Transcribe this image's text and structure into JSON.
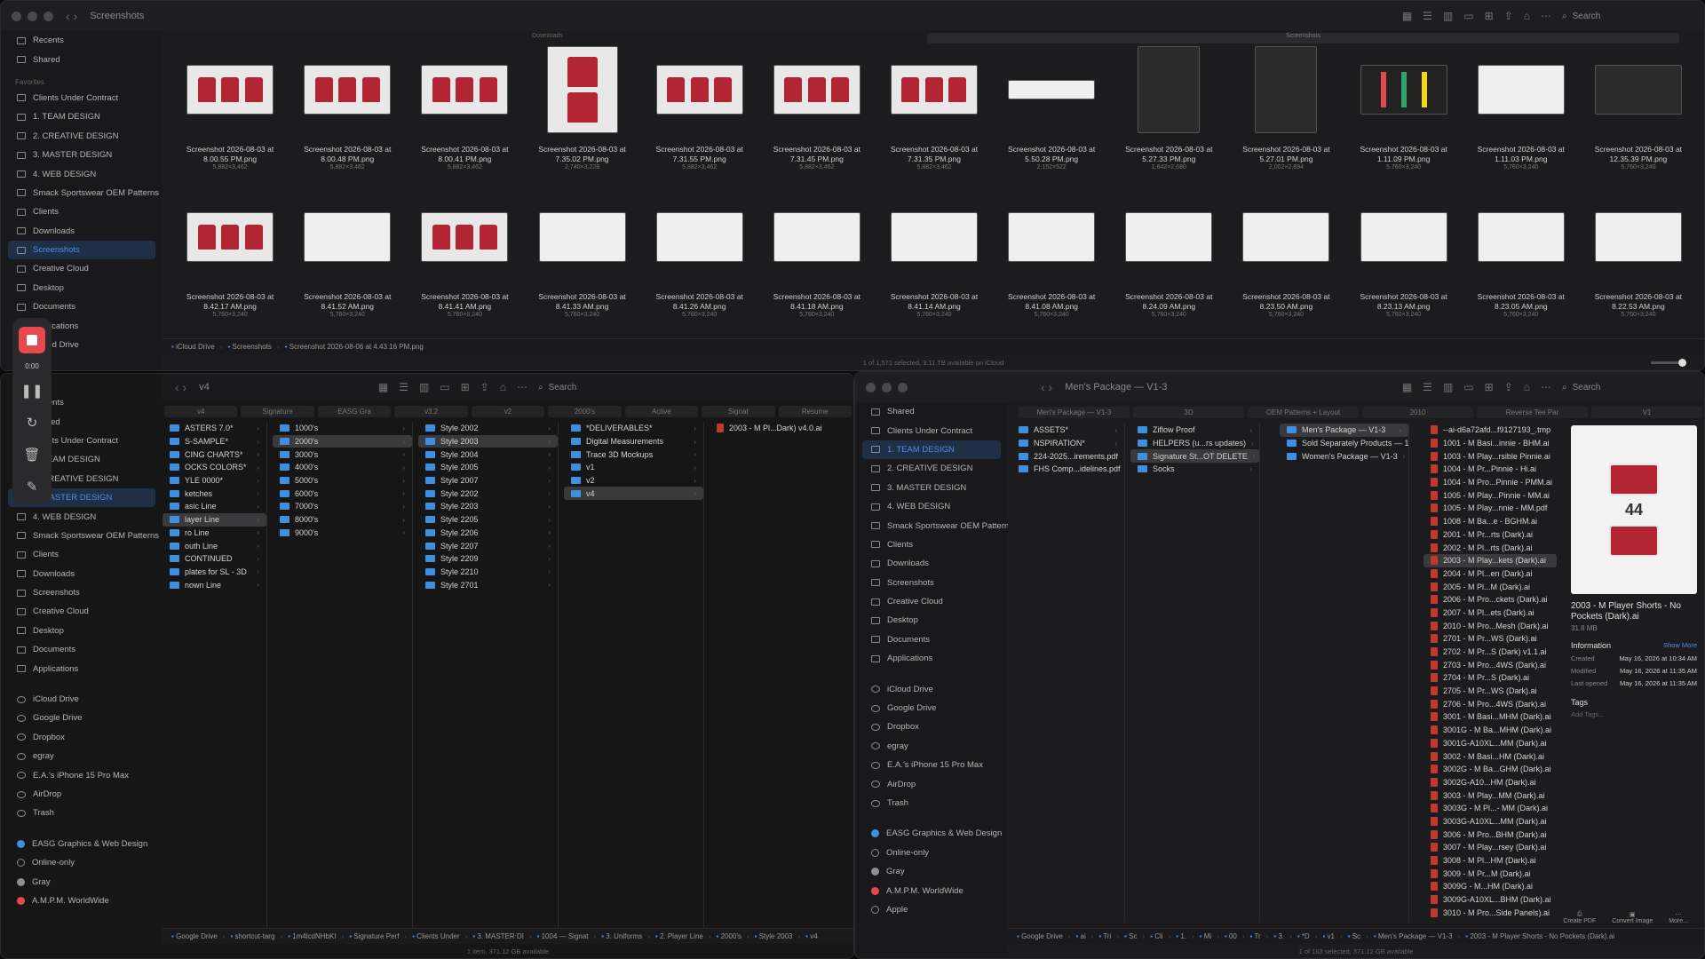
{
  "w1": {
    "title": "Screenshots",
    "search": "Search",
    "tabs": [
      "Downloads",
      "Screenshots"
    ],
    "sidebar": [
      {
        "section": "",
        "items": [
          {
            "label": "Recents",
            "icon": "clock-icon"
          },
          {
            "label": "Shared",
            "icon": "shared-icon"
          }
        ]
      },
      {
        "section": "Favorites",
        "items": [
          {
            "label": "Clients Under Contract"
          },
          {
            "label": "1. TEAM DESIGN"
          },
          {
            "label": "2. CREATIVE DESIGN"
          },
          {
            "label": "3. MASTER DESIGN"
          },
          {
            "label": "4. WEB DESIGN"
          },
          {
            "label": "Smack Sportswear OEM Patterns"
          },
          {
            "label": "Clients"
          },
          {
            "label": "Downloads",
            "icon": "download-icon"
          },
          {
            "label": "Screenshots",
            "sel": true
          },
          {
            "label": "Creative Cloud"
          },
          {
            "label": "Desktop"
          },
          {
            "label": "Documents"
          },
          {
            "label": "Applications"
          },
          {
            "label": "iCloud Drive"
          }
        ]
      }
    ],
    "files": [
      {
        "name": "Screenshot 2026-08-03 at 8.00.55 PM.png",
        "dims": "5,882×3,462",
        "t": "red"
      },
      {
        "name": "Screenshot 2026-08-03 at 8.00.48 PM.png",
        "dims": "5,882×3,462",
        "t": "red"
      },
      {
        "name": "Screenshot 2026-08-03 at 8.00.41 PM.png",
        "dims": "5,882×3,462",
        "t": "red"
      },
      {
        "name": "Screenshot 2026-08-03 at 7.35.02 PM.png",
        "dims": "2,740×3,228",
        "t": "tall"
      },
      {
        "name": "Screenshot 2026-08-03 at 7.31.55 PM.png",
        "dims": "5,882×3,462",
        "t": "red"
      },
      {
        "name": "Screenshot 2026-08-03 at 7.31.45 PM.png",
        "dims": "5,882×3,462",
        "t": "red"
      },
      {
        "name": "Screenshot 2026-08-03 at 7.31.35 PM.png",
        "dims": "5,882×3,462",
        "t": "red"
      },
      {
        "name": "Screenshot 2026-08-03 at 5.50.28 PM.png",
        "dims": "2,152×522",
        "t": "wide"
      },
      {
        "name": "Screenshot 2026-08-03 at 5.27.33 PM.png",
        "dims": "1,642×2,680",
        "t": "darktall"
      },
      {
        "name": "Screenshot 2026-08-03 at 5.27.01 PM.png",
        "dims": "2,002×2,694",
        "t": "darktall"
      },
      {
        "name": "Screenshot 2026-08-03 at 1.11.09 PM.png",
        "dims": "5,760×3,240",
        "t": "bars"
      },
      {
        "name": "Screenshot 2026-08-03 at 1.11.03 PM.png",
        "dims": "5,760×3,240",
        "t": "blank"
      },
      {
        "name": "Screenshot 2026-08-03 at 12.35.39 PM.png",
        "dims": "5,760×3,240",
        "t": "dark"
      },
      {
        "name": "Screenshot 2026-08-03 at 8.42.17 AM.png",
        "dims": "5,760×3,240",
        "t": "red"
      },
      {
        "name": "Screenshot 2026-08-03 at 8.41.52 AM.png",
        "dims": "5,760×3,240",
        "t": "blank"
      },
      {
        "name": "Screenshot 2026-08-03 at 8.41.41 AM.png",
        "dims": "5,760×3,240",
        "t": "red"
      },
      {
        "name": "Screenshot 2026-08-03 at 8.41.33 AM.png",
        "dims": "5,760×3,240",
        "t": "blank"
      },
      {
        "name": "Screenshot 2026-08-03 at 8.41.26 AM.png",
        "dims": "5,760×3,240",
        "t": "blank"
      },
      {
        "name": "Screenshot 2026-08-03 at 8.41.18 AM.png",
        "dims": "5,760×3,240",
        "t": "blank"
      },
      {
        "name": "Screenshot 2026-08-03 at 8.41.14 AM.png",
        "dims": "5,760×3,240",
        "t": "blank"
      },
      {
        "name": "Screenshot 2026-08-03 at 8.41.08 AM.png",
        "dims": "5,760×3,240",
        "t": "blank"
      },
      {
        "name": "Screenshot 2026-08-03 at 8.24.09 AM.png",
        "dims": "5,760×3,240",
        "t": "blank"
      },
      {
        "name": "Screenshot 2026-08-03 at 8.23.50 AM.png",
        "dims": "5,760×3,240",
        "t": "blank"
      },
      {
        "name": "Screenshot 2026-08-03 at 8.23.13 AM.png",
        "dims": "5,760×3,240",
        "t": "blank"
      },
      {
        "name": "Screenshot 2026-08-03 at 8.23.05 AM.png",
        "dims": "5,760×3,240",
        "t": "blank"
      },
      {
        "name": "Screenshot 2026-08-03 at 8.22.53 AM.png",
        "dims": "5,760×3,240",
        "t": "blank"
      }
    ],
    "path": [
      "iCloud Drive",
      "Screenshots",
      "Screenshot 2026-08-06 at 4.43.16 PM.png"
    ],
    "status": "1 of 1,571 selected, 3.11 TB available on iCloud"
  },
  "rec": {
    "time": "0:00"
  },
  "w2": {
    "title": "v4",
    "search": "Search",
    "colheads": [
      "v4",
      "Signature",
      "EASG Gra",
      "v3.2",
      "v2",
      "2000's",
      "Active",
      "Signat",
      "Resume"
    ],
    "sidebar": [
      {
        "label": "Recents"
      },
      {
        "label": "Shared"
      },
      {
        "label": "Clients Under Contract"
      },
      {
        "label": "1. TEAM DESIGN"
      },
      {
        "label": "2. CREATIVE DESIGN"
      },
      {
        "label": "3. MASTER DESIGN",
        "sel": true
      },
      {
        "label": "4. WEB DESIGN"
      },
      {
        "label": "Smack Sportswear OEM Patterns"
      },
      {
        "label": "Clients"
      },
      {
        "label": "Downloads"
      },
      {
        "label": "Screenshots"
      },
      {
        "label": "Creative Cloud"
      },
      {
        "label": "Desktop"
      },
      {
        "label": "Documents"
      },
      {
        "label": "Applications"
      }
    ],
    "locations": [
      "iCloud Drive",
      "Google Drive",
      "Dropbox",
      "egray",
      "E.A.'s iPhone 15 Pro Max",
      "AirDrop",
      "Trash"
    ],
    "tags": [
      {
        "label": "EASG Graphics & Web Design",
        "c": "#3f8ee0"
      },
      {
        "label": "Online-only",
        "c": ""
      },
      {
        "label": "Gray",
        "c": "#8e8e93"
      },
      {
        "label": "A.M.P.M. WorldWide",
        "c": "#e5484d"
      }
    ],
    "col1": [
      "ASTERS 7.0*",
      "S-SAMPLE*",
      "CING CHARTS*",
      "OCKS COLORS*",
      "YLE 0000*",
      "ketches",
      "asic Line",
      "layer Line",
      "ro Line",
      "outh Line",
      "CONTINUED",
      "plates for SL - 3D",
      "nown Line"
    ],
    "col2": [
      "1000's",
      "2000's",
      "3000's",
      "4000's",
      "5000's",
      "6000's",
      "7000's",
      "8000's",
      "9000's"
    ],
    "col3": [
      "Style 2002",
      "Style 2003",
      "Style 2004",
      "Style 2005",
      "Style 2007",
      "Style 2202",
      "Style 2203",
      "Style 2205",
      "Style 2206",
      "Style 2207",
      "Style 2209",
      "Style 2210",
      "Style 2701"
    ],
    "col4": [
      "*DELIVERABLES*",
      "Digital Measurements",
      "Trace 3D Mockups",
      "v1",
      "v2",
      "v4"
    ],
    "col5": [
      "2003 - M Pl...Dark) v4.0.ai"
    ],
    "path": [
      "Google Drive",
      "shortcut-targ",
      "1m4lcdNHbKI",
      "Signature Perf",
      "Clients Under",
      "3. MASTER DI",
      "1004 — Signat",
      "3. Uniforms",
      "2. Player Line",
      "2000's",
      "Style 2003",
      "v4"
    ],
    "status": "1 item, 371.12 GB available"
  },
  "w3": {
    "title": "Men's Package — V1-3",
    "search": "Search",
    "tabs": [
      "Men's Package — V1-3",
      "3D",
      "OEM Patterns + Layout",
      "2010",
      "Reverse Tee Par",
      "V1"
    ],
    "sidebar": [
      {
        "label": "Shared"
      },
      {
        "label": "Clients Under Contract"
      },
      {
        "label": "1. TEAM DESIGN",
        "sel": true
      },
      {
        "label": "2. CREATIVE DESIGN"
      },
      {
        "label": "3. MASTER DESIGN"
      },
      {
        "label": "4. WEB DESIGN"
      },
      {
        "label": "Smack Sportswear OEM Patterns"
      },
      {
        "label": "Clients"
      },
      {
        "label": "Downloads"
      },
      {
        "label": "Screenshots"
      },
      {
        "label": "Creative Cloud"
      },
      {
        "label": "Desktop"
      },
      {
        "label": "Documents"
      },
      {
        "label": "Applications"
      }
    ],
    "locations": [
      "iCloud Drive",
      "Google Drive",
      "Dropbox",
      "egray",
      "E.A.'s iPhone 15 Pro Max",
      "AirDrop",
      "Trash"
    ],
    "tags": [
      {
        "label": "EASG Graphics & Web Design",
        "c": "#3f8ee0"
      },
      {
        "label": "Online-only",
        "c": ""
      },
      {
        "label": "Gray",
        "c": "#8e8e93"
      },
      {
        "label": "A.M.P.M. WorldWide",
        "c": "#e5484d"
      },
      {
        "label": "Apple",
        "c": ""
      }
    ],
    "col1": [
      "ASSETS*",
      "NSPIRATION*",
      "224-2025...irements.pdf",
      "FHS Comp...idelines.pdf"
    ],
    "col2": [
      "Ziflow Proof",
      "HELPERS (u...rs updates)",
      "Signature St...OT DELETE",
      "Socks"
    ],
    "col3": [
      "Men's Package — V1-3",
      "Sold Separately Products — 1",
      "Women's Package — V1-3"
    ],
    "col4": [
      "--ai-d6a72afd...f9127193_.tmp",
      "1001 - M Basi...innie - BHM.ai",
      "1003 - M Play...rsible Pinnie.ai",
      "1004 - M Pr...Pinnie - Hi.ai",
      "1004 - M Pro...Pinnie - PMM.ai",
      "1005 - M Play...Pinnie - MM.ai",
      "1005 - M Play...nnie - MM.pdf",
      "1008 - M Ba...e - BGHM.ai",
      "2001 - M Pr...rts (Dark).ai",
      "2002 - M Pl...rts (Dark).ai",
      "2003 - M Play...kets (Dark).ai",
      "2004 - M Pl...en (Dark).ai",
      "2005 - M Pl...M (Dark).ai",
      "2006 - M Pro...ckets (Dark).ai",
      "2007 - M Pl...ets (Dark).ai",
      "2010 - M Pro...Mesh (Dark).ai",
      "2701 - M Pr...WS (Dark).ai",
      "2702 - M Pr...S (Dark) v1.1.ai",
      "2703 - M Pro...4WS (Dark).ai",
      "2704 - M Pr...S (Dark).ai",
      "2705 - M Pr...WS (Dark).ai",
      "2706 - M Pro...4WS (Dark).ai",
      "3001 - M Basi...MHM (Dark).ai",
      "3001G - M Ba...MHM (Dark).ai",
      "3001G-A10XL...MM (Dark).ai",
      "3002 - M Basi...HM (Dark).ai",
      "3002G - M Ba...GHM (Dark).ai",
      "3002G-A10...HM (Dark).ai",
      "3003 - M Play...MM (Dark).ai",
      "3003G - M Pl...- MM (Dark).ai",
      "3003G-A10XL...MM (Dark).ai",
      "3006 - M Pro...BHM (Dark).ai",
      "3007 - M Play...rsey (Dark).ai",
      "3008 - M Pl...HM (Dark).ai",
      "3009 - M Pr...M (Dark).ai",
      "3009G - M...HM (Dark).ai",
      "3009G-A10XL...BHM (Dark).ai",
      "3010 - M Pro...Side Panels).ai"
    ],
    "preview": {
      "name": "2003 - M Player Shorts - No Pockets (Dark).ai",
      "size": "31.8 MB",
      "info": "Information",
      "more": "Show More",
      "created_k": "Created",
      "created_v": "May 16, 2026 at 10:34 AM",
      "modified_k": "Modified",
      "modified_v": "May 16, 2026 at 11:35 AM",
      "opened_k": "Last opened",
      "opened_v": "May 16, 2026 at 11:35 AM",
      "tags": "Tags",
      "addtags": "Add Tags...",
      "actions": [
        "Create PDF",
        "Convert Image",
        "More..."
      ],
      "badge": "44"
    },
    "path": [
      "Google Drive",
      "ai",
      "Tri",
      "Sc",
      "Cli",
      "1.",
      "Mi",
      "00",
      "Tr",
      "3.",
      "*D",
      "v1",
      "Sc",
      "Men's Package — V1-3",
      "2003 - M Player Shorts - No Pockets (Dark).ai"
    ],
    "status": "1 of 163 selected, 371.12 GB available"
  }
}
